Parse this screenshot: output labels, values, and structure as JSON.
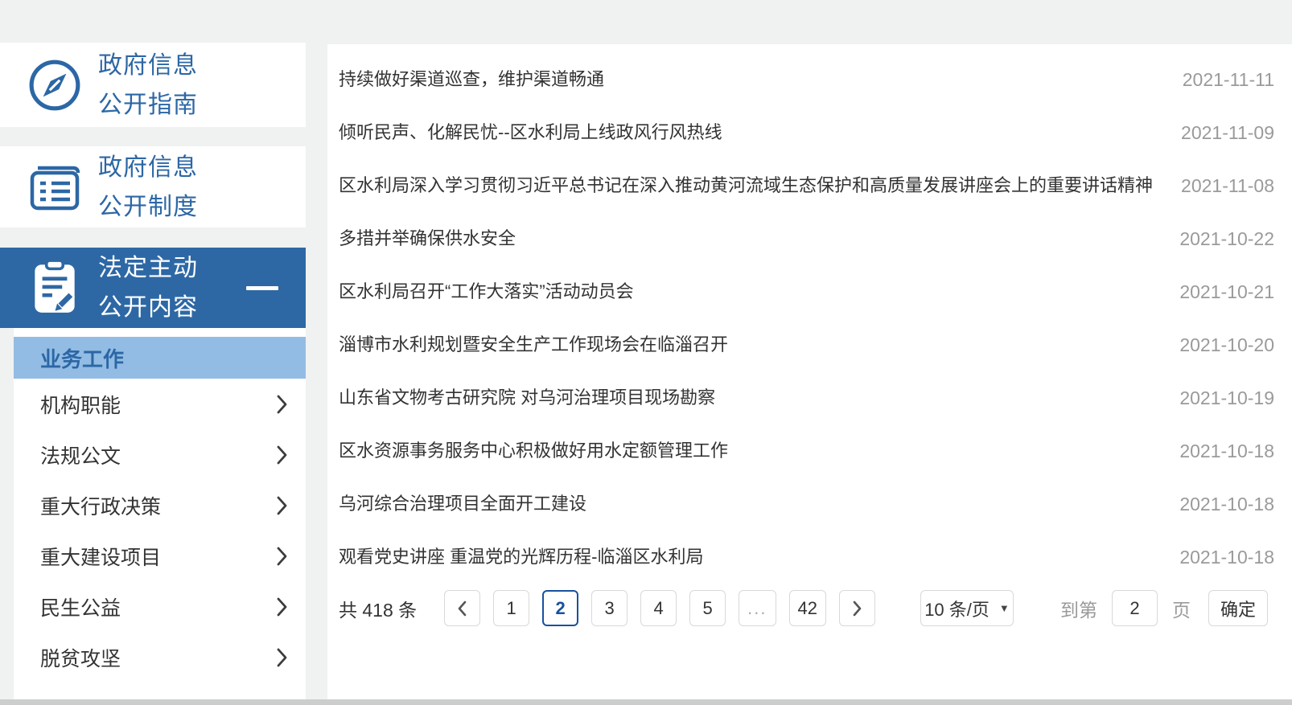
{
  "colors": {
    "accent_blue": "#2d68a5",
    "active_submenu_bg": "#92bce4",
    "active_page_border": "#17519e",
    "date_gray": "#9a9a9a",
    "page_bg": "#f0f1f1"
  },
  "sidebar": {
    "guide": {
      "line1": "政府信息",
      "line2": "公开指南",
      "icon": "compass-icon"
    },
    "system": {
      "line1": "政府信息",
      "line2": "公开制度",
      "icon": "document-list-icon"
    },
    "active": {
      "line1": "法定主动",
      "line2": "公开内容",
      "icon": "clipboard-pencil-icon",
      "state": "expanded"
    },
    "active_submenu": "业务工作",
    "menu": [
      {
        "label": "机构职能"
      },
      {
        "label": "法规公文"
      },
      {
        "label": "重大行政决策"
      },
      {
        "label": "重大建设项目"
      },
      {
        "label": "民生公益"
      },
      {
        "label": "脱贫攻坚"
      }
    ]
  },
  "news": {
    "items": [
      {
        "title": "持续做好渠道巡查，维护渠道畅通",
        "date": "2021-11-11"
      },
      {
        "title": "倾听民声、化解民忧--区水利局上线政风行风热线",
        "date": "2021-11-09"
      },
      {
        "title": "区水利局深入学习贯彻习近平总书记在深入推动黄河流域生态保护和高质量发展讲座会上的重要讲话精神",
        "date": "2021-11-08"
      },
      {
        "title": "多措并举确保供水安全",
        "date": "2021-10-22"
      },
      {
        "title": "区水利局召开“工作大落实”活动动员会",
        "date": "2021-10-21"
      },
      {
        "title": "淄博市水利规划暨安全生产工作现场会在临淄召开",
        "date": "2021-10-20"
      },
      {
        "title": "山东省文物考古研究院 对乌河治理项目现场勘察",
        "date": "2021-10-19"
      },
      {
        "title": "区水资源事务服务中心积极做好用水定额管理工作",
        "date": "2021-10-18"
      },
      {
        "title": "乌河综合治理项目全面开工建设",
        "date": "2021-10-18"
      },
      {
        "title": "观看党史讲座 重温党的光辉历程-临淄区水利局",
        "date": "2021-10-18"
      }
    ]
  },
  "pagination": {
    "total_label": "共 418 条",
    "pages": [
      "1",
      "2",
      "3",
      "4",
      "5",
      "...",
      "42"
    ],
    "active_page": "2",
    "ellipsis": "...",
    "page_size_label": "10 条/页",
    "dropdown_arrow": "▼",
    "goto_prefix": "到第",
    "goto_value": "2",
    "goto_suffix": "页",
    "confirm_label": "确定"
  }
}
